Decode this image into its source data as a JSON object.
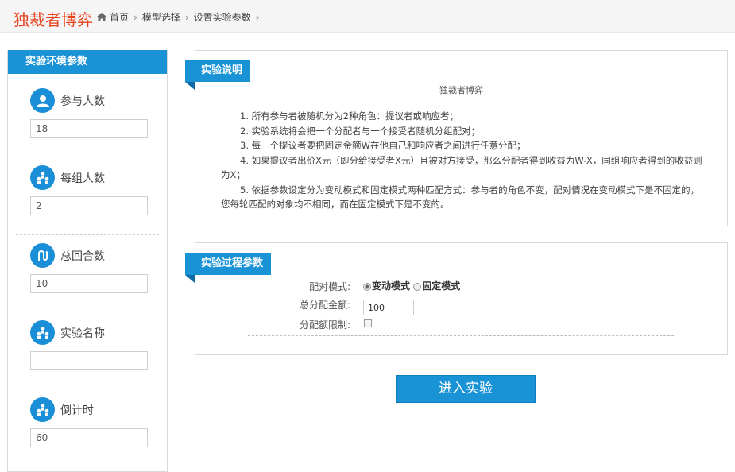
{
  "header": {
    "title": "独裁者博弈",
    "breadcrumbs": [
      "首页",
      "模型选择",
      "设置实验参数"
    ]
  },
  "left_panel": {
    "title": "实验环境参数",
    "params": [
      {
        "label": "参与人数",
        "value": "18",
        "icon": "person-icon"
      },
      {
        "label": "每组人数",
        "value": "2",
        "icon": "group-icon"
      },
      {
        "label": "总回合数",
        "value": "10",
        "icon": "rounds-icon"
      },
      {
        "label": "实验名称",
        "value": "",
        "icon": "group-icon"
      },
      {
        "label": "倒计时",
        "value": "60",
        "icon": "group-icon"
      }
    ]
  },
  "description": {
    "tag": "实验说明",
    "title": "独裁者博弈",
    "lines": [
      "1. 所有参与者被随机分为2种角色：提议者或响应者；",
      "2. 实验系统将会把一个分配者与一个接受者随机分组配对；",
      "3. 每一个提议者要把固定金额W在他自己和响应者之间进行任意分配；",
      "4. 如果提议者出价X元（即分给接受者X元）且被对方接受，那么分配者得到收益为W-X，同组响应者得到的收益则为X；",
      "5. 依据参数设定分为变动模式和固定模式两种匹配方式：参与者的角色不变，配对情况在变动模式下是不固定的，您每轮匹配的对象均不相同，而在固定模式下是不变的。"
    ]
  },
  "process": {
    "tag": "实验过程参数",
    "match_mode_label": "配对模式:",
    "mode_options": [
      "变动模式",
      "固定模式"
    ],
    "selected_mode": "变动模式",
    "total_amount_label": "总分配金额:",
    "total_amount": "100",
    "limit_label": "分配额限制:"
  },
  "enter_button": "进入实验",
  "colors": {
    "accent": "#1a93d6",
    "brand_title": "#e8421c"
  }
}
